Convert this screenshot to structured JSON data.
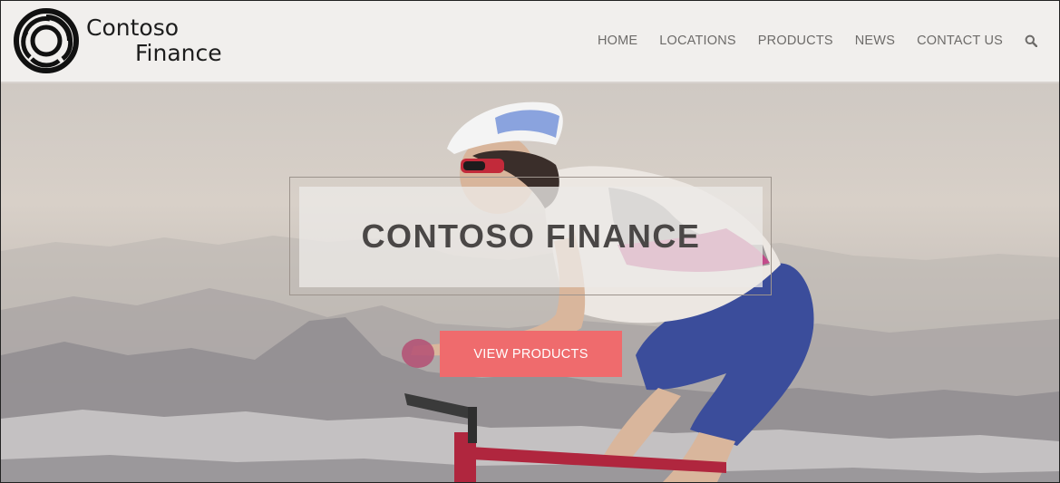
{
  "brand": {
    "name_line1": "Contoso",
    "name_line2": "Finance"
  },
  "nav": {
    "items": [
      "HOME",
      "LOCATIONS",
      "PRODUCTS",
      "NEWS",
      "CONTACT US"
    ],
    "search_icon": "search-icon"
  },
  "hero": {
    "title": "CONTOSO FINANCE",
    "cta_label": "VIEW PRODUCTS"
  },
  "colors": {
    "header_bg": "#f1efed",
    "nav_text": "#6d6b69",
    "cta_bg": "#ef6b6d",
    "title_text": "#4a4746"
  }
}
